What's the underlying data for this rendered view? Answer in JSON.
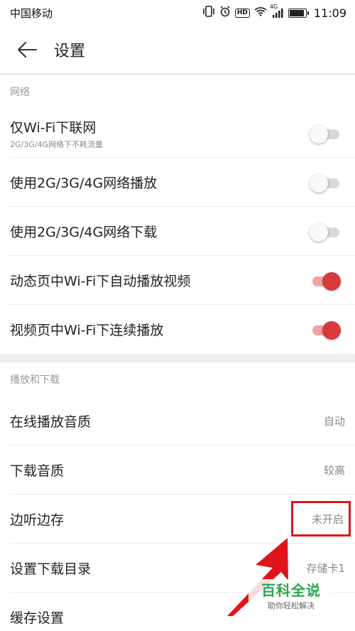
{
  "status_bar": {
    "carrier": "中国移动",
    "hd": "HD",
    "network": "4G",
    "time": "11:09",
    "battery_level": 0.92
  },
  "header": {
    "back_icon": "back-arrow-icon",
    "title": "设置"
  },
  "sections": {
    "network": {
      "header": "网络",
      "items": [
        {
          "title": "仅Wi-Fi下联网",
          "subtitle": "2G/3G/4G网络下不耗流量",
          "enabled": false
        },
        {
          "title": "使用2G/3G/4G网络播放",
          "enabled": false
        },
        {
          "title": "使用2G/3G/4G网络下载",
          "enabled": false
        },
        {
          "title": "动态页中Wi-Fi下自动播放视频",
          "enabled": true
        },
        {
          "title": "视频页中Wi-Fi下连续播放",
          "enabled": true
        }
      ]
    },
    "playback": {
      "header": "播放和下载",
      "items": [
        {
          "title": "在线播放音质",
          "value": "自动"
        },
        {
          "title": "下载音质",
          "value": "较高"
        },
        {
          "title": "边听边存",
          "value": "未开启"
        },
        {
          "title": "设置下载目录",
          "value": "存储卡1"
        },
        {
          "title": "缓存设置",
          "value": ""
        }
      ]
    }
  },
  "watermark": {
    "main": "百科全说",
    "sub": "助你轻松解决"
  },
  "colors": {
    "accent": "#d63a3a",
    "accent_track": "#f1a3a3",
    "highlight": "#e0141b",
    "watermark_green": "#27a84a"
  }
}
